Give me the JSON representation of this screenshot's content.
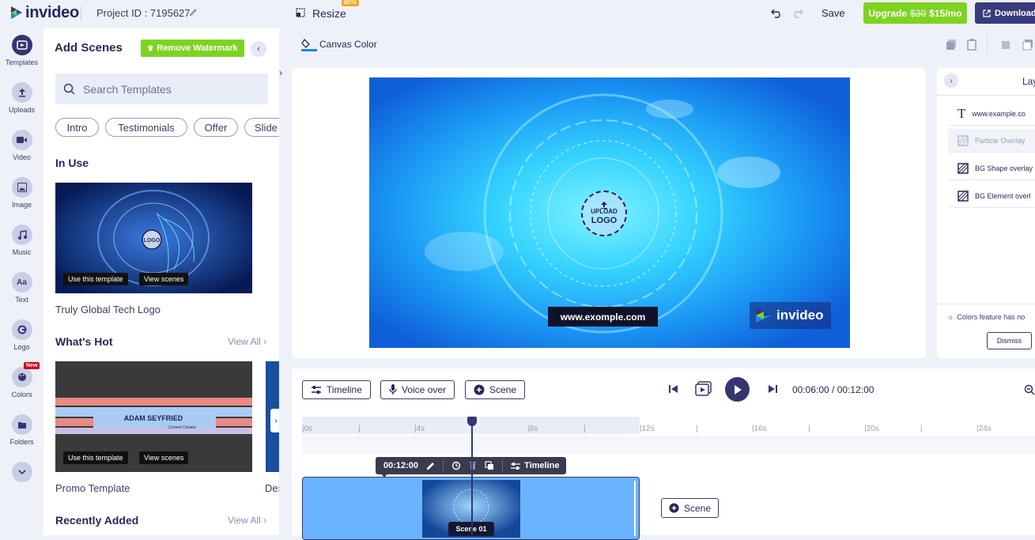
{
  "topbar": {
    "brand": "invideo",
    "project_id": "Project ID : 7195627",
    "resize_label": "Resize",
    "beta_badge": "BETA",
    "save_label": "Save",
    "upgrade_label": "Upgrade",
    "upgrade_old_price": "$30",
    "upgrade_price": "$15/mo",
    "download_label": "Download"
  },
  "rail": {
    "items": [
      {
        "label": "Templates",
        "icon": "templates-icon"
      },
      {
        "label": "Uploads",
        "icon": "upload-icon"
      },
      {
        "label": "Video",
        "icon": "video-icon"
      },
      {
        "label": "Image",
        "icon": "image-icon"
      },
      {
        "label": "Music",
        "icon": "music-icon"
      },
      {
        "label": "Text",
        "icon": "text-icon"
      },
      {
        "label": "Logo",
        "icon": "logo-icon"
      },
      {
        "label": "Colors",
        "icon": "palette-icon"
      },
      {
        "label": "Folders",
        "icon": "folder-icon"
      }
    ],
    "new_badge": "New"
  },
  "panel": {
    "title": "Add Scenes",
    "remove_watermark": "Remove Watermark",
    "search_placeholder": "Search Templates",
    "chips": [
      "Intro",
      "Testimonials",
      "Offer",
      "Slide"
    ],
    "in_use_title": "In Use",
    "in_use_card": {
      "caption": "Truly Global Tech Logo",
      "use_btn": "Use this template",
      "view_btn": "View scenes",
      "logo_text": "LOGO"
    },
    "whats_hot_title": "What's Hot",
    "view_all": "View All",
    "hot_card": {
      "caption": "Promo Template",
      "use_btn": "Use this template",
      "view_btn": "View scenes",
      "name": "ADAM SEYFRIED",
      "role": "Content Creator"
    },
    "hot_card2_caption": "Des",
    "recently_added_title": "Recently Added",
    "view_all_2": "View All"
  },
  "canvas": {
    "color_label": "Canvas Color",
    "upload_logo_line1": "UPLOAD",
    "upload_logo_line2": "LOGO",
    "url_text": "www.exomple.com",
    "watermark": "invideo"
  },
  "layers": {
    "title": "Lay",
    "items": [
      {
        "label": "www.example.co",
        "icon": "text-layer-icon"
      },
      {
        "label": "Particle Overlay",
        "icon": "overlay-layer-icon"
      },
      {
        "label": "BG Shape overlay",
        "icon": "overlay-layer-icon"
      },
      {
        "label": "BG Element overl",
        "icon": "overlay-layer-icon"
      }
    ],
    "footer_note": "Colors feature has no",
    "dismiss_label": "Dismiss"
  },
  "timeline": {
    "timeline_btn": "Timeline",
    "voiceover_btn": "Voice over",
    "scene_btn": "Scene",
    "current_time": "00:06:00",
    "total_time": "00:12:00",
    "ticks": [
      "0s",
      "4s",
      "8s",
      "12s",
      "16s",
      "20s",
      "24s"
    ],
    "scene_duration": "00:12:00",
    "scene_timeline_label": "Timeline",
    "scene_label": "Scene 01",
    "add_scene": "Scene"
  },
  "colors": {
    "brand": "#34366f",
    "green": "#7ed321",
    "preview_blue": "#1a84f0"
  }
}
